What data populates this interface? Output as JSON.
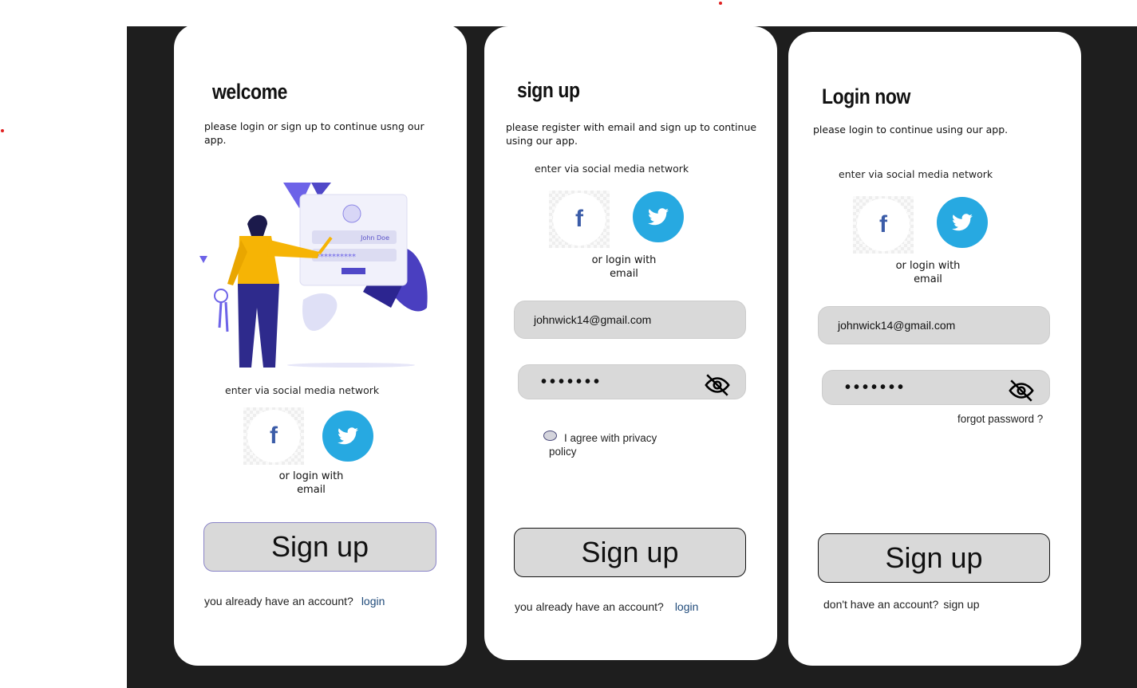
{
  "screens": [
    {
      "title": "welcome",
      "subtitle": "please login or sign up to continue usng our app.",
      "social_label": "enter via social media network",
      "or_email": "or login with email",
      "button": "Sign up",
      "footer_text": "you already have an account?",
      "footer_link": "login",
      "illustration": {
        "name_field": "John Doe",
        "password_field": "**********"
      }
    },
    {
      "title": "sign up",
      "subtitle": "please register with email and sign up to continue using our app.",
      "social_label": "enter via social media network",
      "or_email": "or login with email",
      "email": "johnwick14@gmail.com",
      "password": "•••••••",
      "checkbox_label": "I agree with privacy policy",
      "checkbox_checked": false,
      "button": "Sign up",
      "footer_text": "you already have an account?",
      "footer_link": "login"
    },
    {
      "title": "Login now",
      "subtitle": "please login to continue using our app.",
      "social_label": "enter via social media network",
      "or_email": "or login with email",
      "email": "johnwick14@gmail.com",
      "password": "•••••••",
      "forgot": "forgot password ?",
      "button": "Sign up",
      "footer_text": "don't have an account?",
      "footer_link": "sign up"
    }
  ],
  "icons": {
    "facebook": "facebook-icon",
    "twitter": "twitter-icon",
    "eye_off": "eye-off-icon"
  },
  "colors": {
    "background": "#1e1e1e",
    "twitter": "#27a9e1",
    "facebook": "#3b5ca8",
    "input": "#d9d9d9",
    "link": "#1f4a7a"
  }
}
